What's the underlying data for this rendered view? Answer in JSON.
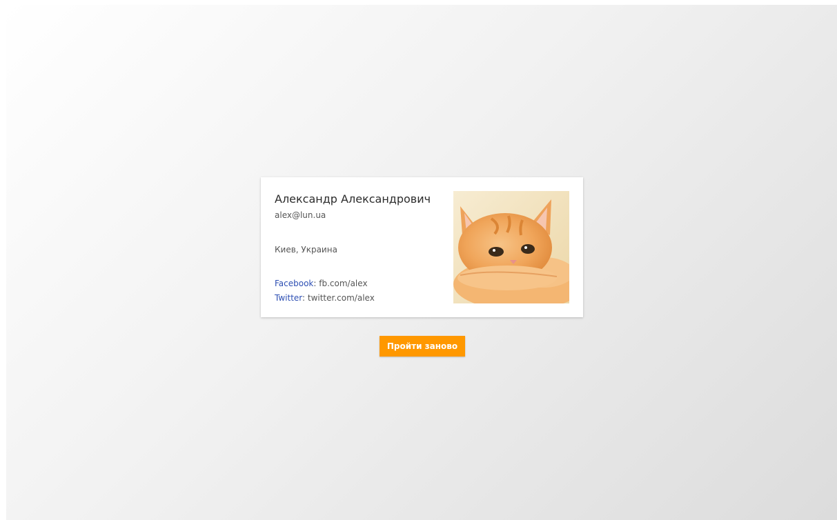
{
  "profile": {
    "name": "Александр Александрович",
    "email": "alex@lun.ua",
    "location": "Киев, Украина",
    "facebook_label": "Facebook",
    "facebook_value": "fb.com/alex",
    "twitter_label": "Twitter",
    "twitter_value": "twitter.com/alex",
    "photo_icon": "kitten-photo"
  },
  "actions": {
    "retry_label": "Пройти заново"
  },
  "colors": {
    "accent": "#ff9800",
    "link": "#2d4fb3"
  }
}
